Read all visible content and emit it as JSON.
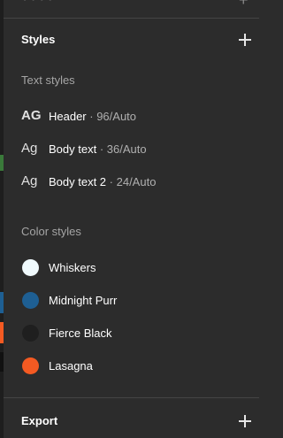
{
  "top_strip": {
    "ghost_text": "• • • •"
  },
  "styles_section": {
    "title": "Styles"
  },
  "text_styles": {
    "heading": "Text styles",
    "items": [
      {
        "icon": "AG",
        "name": "Header",
        "separator": " · ",
        "meta": "96/Auto"
      },
      {
        "icon": "Ag",
        "name": "Body text",
        "separator": " · ",
        "meta": "36/Auto"
      },
      {
        "icon": "Ag",
        "name": "Body text 2",
        "separator": " · ",
        "meta": "24/Auto"
      }
    ]
  },
  "color_styles": {
    "heading": "Color styles",
    "items": [
      {
        "name": "Whiskers",
        "color": "#f0fafd"
      },
      {
        "name": "Midnight Purr",
        "color": "#1e5f93"
      },
      {
        "name": "Fierce Black",
        "color": "#1f1f1f"
      },
      {
        "name": "Lasagna",
        "color": "#f45a22"
      }
    ]
  },
  "export_section": {
    "title": "Export"
  },
  "theme": {
    "panel_bg": "#2c2c2c",
    "divider": "#444444",
    "muted_text": "#a5a5a5"
  }
}
